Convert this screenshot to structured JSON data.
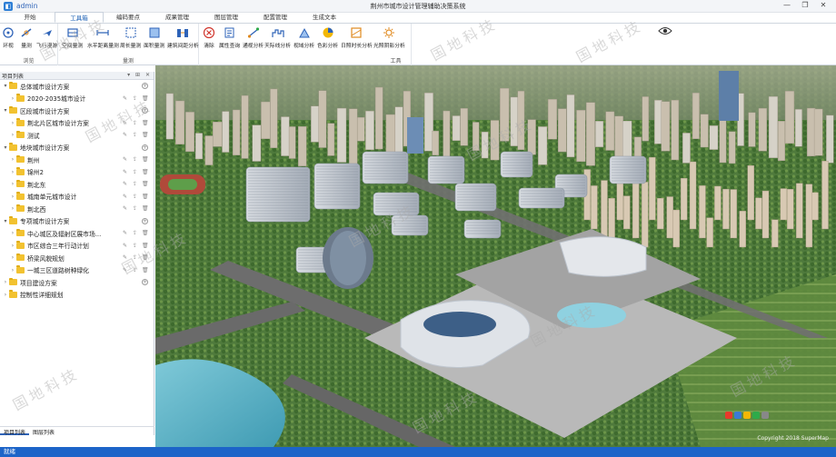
{
  "window": {
    "user": "admin",
    "title": "荆州市城市设计管理辅助决策系统",
    "controls": [
      "—",
      "❐",
      "✕"
    ]
  },
  "menu": {
    "tabs": [
      "开始",
      "工具箱",
      "编码要点",
      "成果管理",
      "图层管理",
      "配置管理",
      "生成文本"
    ],
    "active_index": 1
  },
  "ribbon": {
    "groups": [
      {
        "label": "浏览",
        "tools": [
          "环视",
          "量测",
          "飞行漫游"
        ]
      },
      {
        "label": "量测",
        "tools": [
          "空间量测",
          "水平距离量测",
          "周长量测",
          "面积量测",
          "建筑间距分析"
        ]
      },
      {
        "label": "工具",
        "tools": [
          "清除",
          "属性查询",
          "通视分析",
          "天际线分析",
          "视域分析",
          "色彩分析",
          "日照时长分析",
          "光照阴影分析"
        ]
      }
    ]
  },
  "panel": {
    "title": "项目列表",
    "header_controls": "▾ ⊞ ✕",
    "tree": [
      {
        "text": "总体城市设计方案",
        "level": 0,
        "expanded": true,
        "add": true
      },
      {
        "text": "2020-2035城市设计",
        "level": 1,
        "expanded": false,
        "actions": true
      },
      {
        "text": "区段城市设计方案",
        "level": 0,
        "expanded": true,
        "add": true
      },
      {
        "text": "荆北片区城市设计方案",
        "level": 1,
        "expanded": false,
        "actions": true
      },
      {
        "text": "测试",
        "level": 1,
        "expanded": false,
        "actions": true
      },
      {
        "text": "地块城市设计方案",
        "level": 0,
        "expanded": true,
        "add": true
      },
      {
        "text": "荆州",
        "level": 1,
        "expanded": false,
        "actions": true
      },
      {
        "text": "锦州2",
        "level": 1,
        "expanded": false,
        "actions": true
      },
      {
        "text": "荆北东",
        "level": 1,
        "expanded": false,
        "actions": true
      },
      {
        "text": "城南单元城市设计",
        "level": 1,
        "expanded": false,
        "actions": true
      },
      {
        "text": "荆北西",
        "level": 1,
        "expanded": false,
        "actions": true
      },
      {
        "text": "专项城市设计方案",
        "level": 0,
        "expanded": true,
        "add": true
      },
      {
        "text": "中心城区及辐射区展市场...",
        "level": 1,
        "expanded": false,
        "actions": true
      },
      {
        "text": "市区综合三年行动计划",
        "level": 1,
        "expanded": false,
        "actions": true
      },
      {
        "text": "桥梁风貌规划",
        "level": 1,
        "expanded": false,
        "actions": true
      },
      {
        "text": "一城三区道路树种绿化",
        "level": 1,
        "expanded": false,
        "actions": true
      },
      {
        "text": "项目建设方案",
        "level": 0,
        "expanded": false,
        "add": true
      },
      {
        "text": "控制性详细规划",
        "level": 0,
        "expanded": false,
        "add": false
      }
    ],
    "bottom_tabs": [
      "项目列表",
      "图层列表"
    ]
  },
  "scene": {
    "copyright": "Copyright 2018 SuperMap",
    "logo_colors": [
      "#e8392b",
      "#3a7bd5",
      "#f2b705",
      "#2eaa4a",
      "#888888"
    ]
  },
  "status": {
    "text": "就绪"
  },
  "watermark": {
    "text": "国地科技"
  }
}
